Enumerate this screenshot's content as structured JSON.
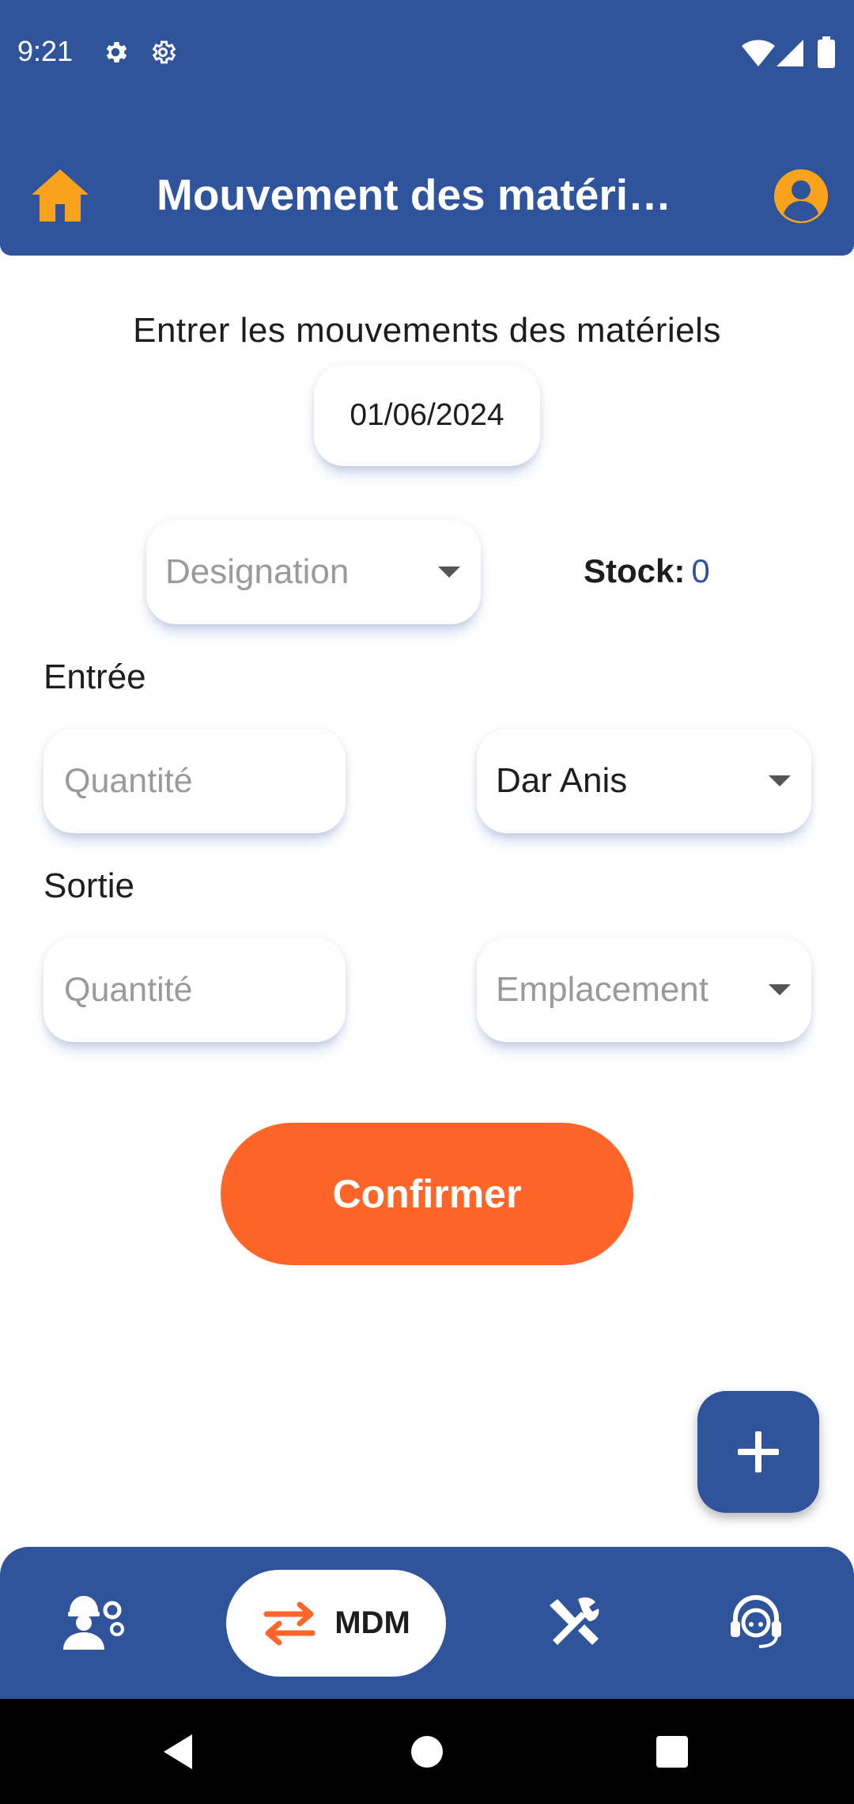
{
  "status_bar": {
    "time": "9:21",
    "left_icons": [
      "gear-icon",
      "settings-outline-icon"
    ],
    "right_icons": [
      "wifi-icon",
      "signal-icon",
      "battery-icon"
    ]
  },
  "app_bar": {
    "title": "Mouvement des matéri…",
    "left_icon": "home-icon",
    "right_icon": "account-circle-icon"
  },
  "form": {
    "heading": "Entrer les mouvements des matériels",
    "date": "01/06/2024",
    "designation_placeholder": "Designation",
    "stock_label": "Stock:",
    "stock_value": "0",
    "entree_label": "Entrée",
    "entree_qty_placeholder": "Quantité",
    "entree_location": "Dar Anis",
    "sortie_label": "Sortie",
    "sortie_qty_placeholder": "Quantité",
    "sortie_location_placeholder": "Emplacement",
    "confirm_label": "Confirmer"
  },
  "fab": {
    "icon": "plus-icon"
  },
  "bottom_nav": {
    "items": [
      {
        "icon": "worker-settings-icon",
        "label": ""
      },
      {
        "icon": "swap-arrows-icon",
        "label": "MDM",
        "active": true
      },
      {
        "icon": "tools-icon",
        "label": ""
      },
      {
        "icon": "support-agent-icon",
        "label": ""
      }
    ]
  },
  "colors": {
    "primary": "#2f549b",
    "accent_orange": "#ff6529",
    "home_icon": "#f9a31c",
    "text_dark": "#1d1d1d",
    "placeholder": "#9a9a9a"
  }
}
